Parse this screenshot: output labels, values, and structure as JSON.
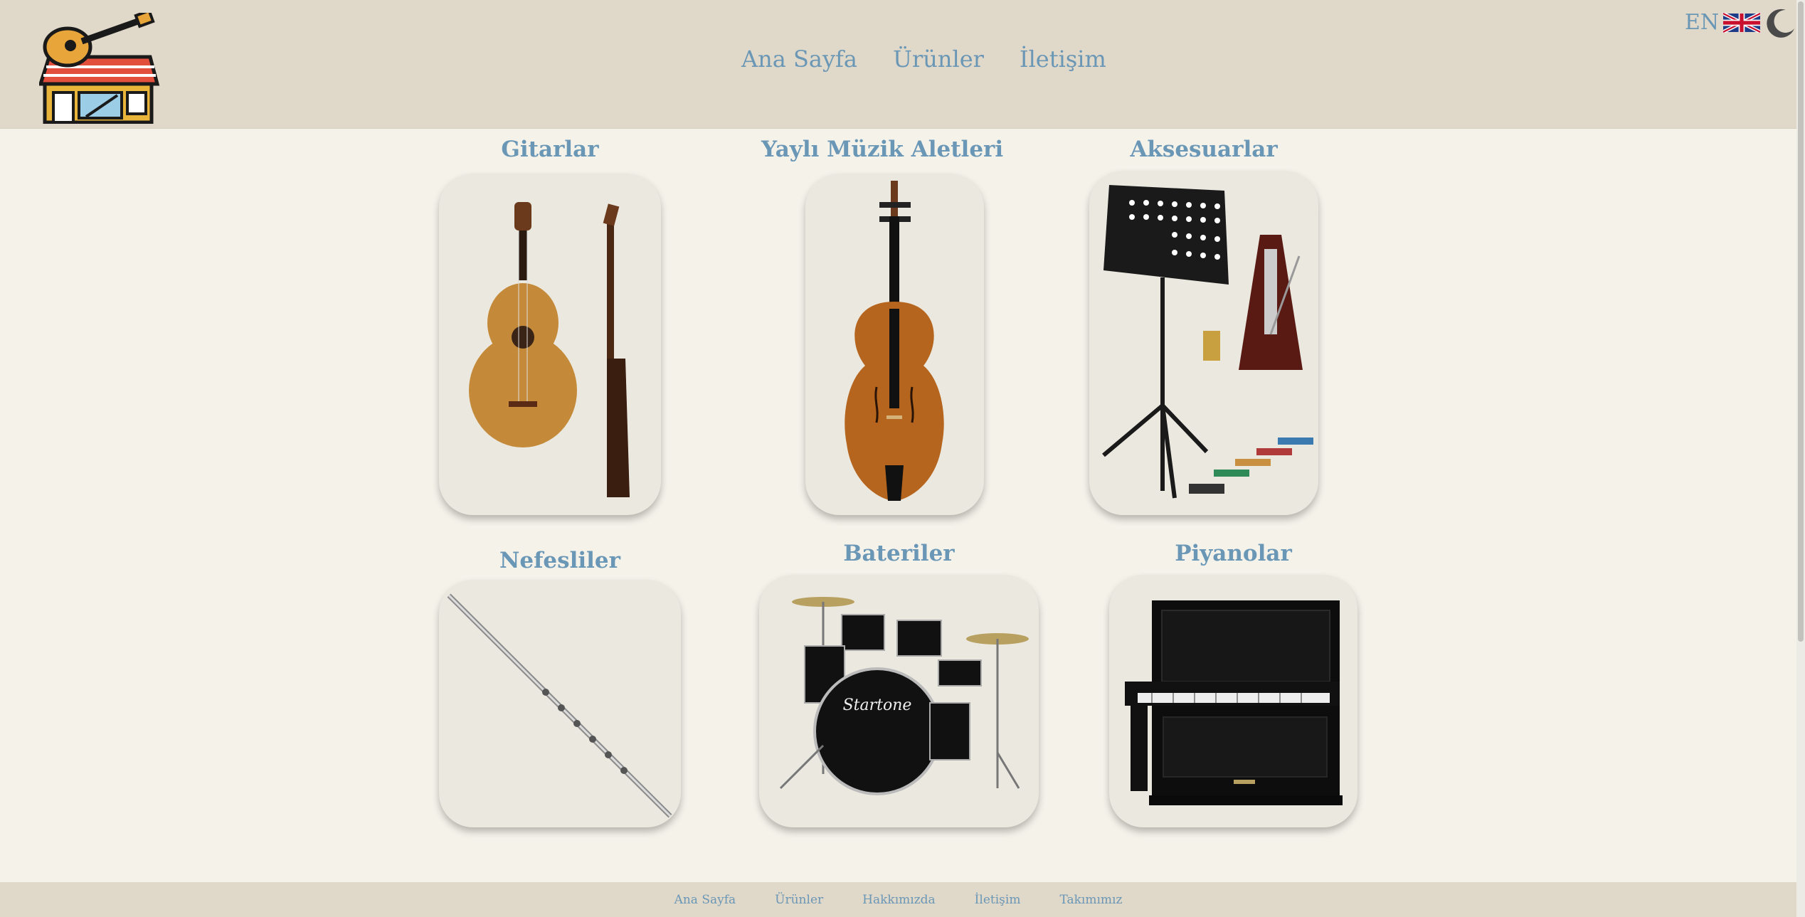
{
  "nav": {
    "items": [
      {
        "label": "Ana Sayfa"
      },
      {
        "label": "Ürünler"
      },
      {
        "label": "İletişim"
      }
    ]
  },
  "lang": {
    "code": "EN",
    "flag_icon": "uk-flag-icon"
  },
  "theme_toggle_icon": "moon-icon",
  "categories": [
    {
      "title": "Gitarlar",
      "image": "classical-guitar"
    },
    {
      "title": "Yaylı Müzik Aletleri",
      "image": "violin"
    },
    {
      "title": "Aksesuarlar",
      "image": "music-stand-metronome-footstools"
    },
    {
      "title": "Nefesliler",
      "image": "flute"
    },
    {
      "title": "Bateriler",
      "image": "drum-kit",
      "drum_brand": "Startone"
    },
    {
      "title": "Piyanolar",
      "image": "upright-piano"
    }
  ],
  "footer": {
    "links": [
      {
        "label": "Ana Sayfa"
      },
      {
        "label": "Ürünler"
      },
      {
        "label": "Hakkımızda"
      },
      {
        "label": "İletişim"
      },
      {
        "label": "Takımımız"
      }
    ]
  },
  "colors": {
    "header_bg": "#e0d8c8",
    "page_bg": "#f5f2ea",
    "card_bg": "#ebe8df",
    "link": "#6a97b6"
  }
}
